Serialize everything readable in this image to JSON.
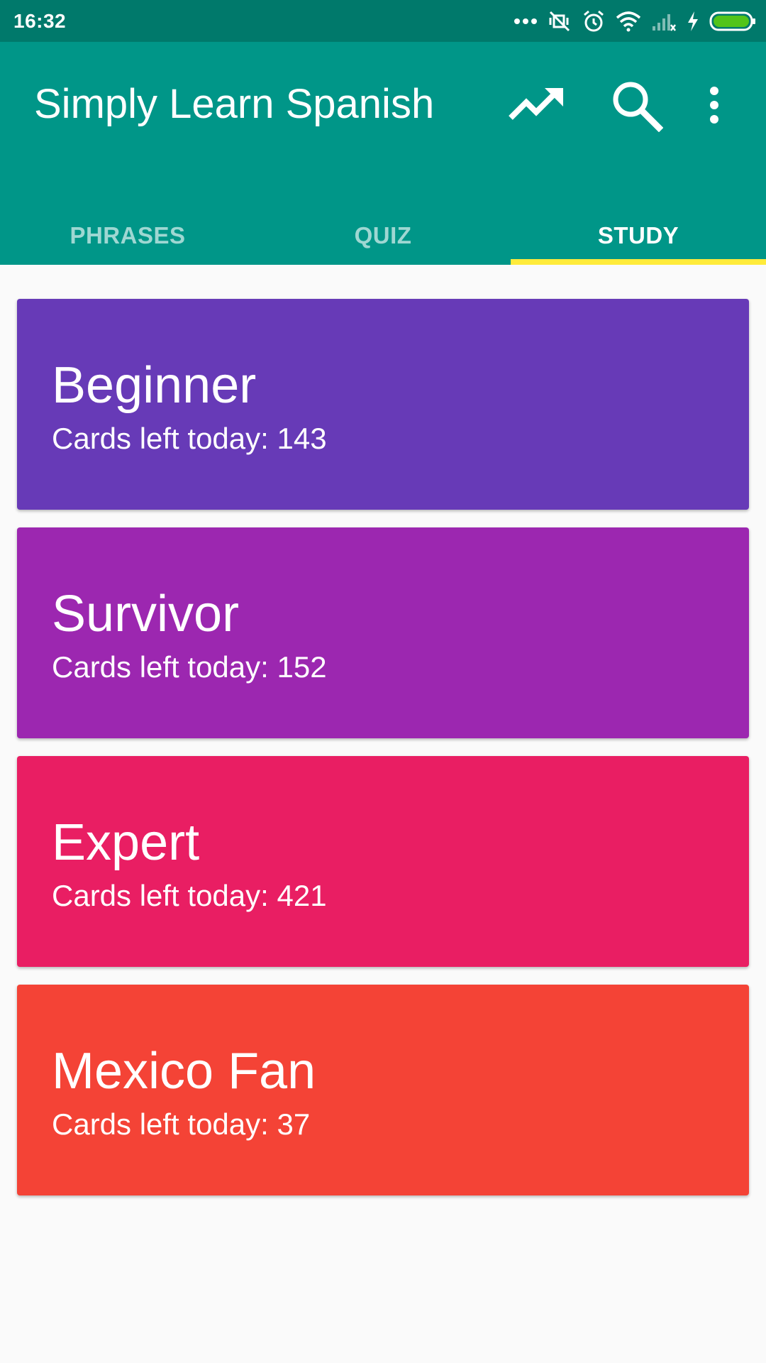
{
  "status_bar": {
    "time": "16:32",
    "icons": [
      "more-dots-icon",
      "vibrate-off-icon",
      "alarm-icon",
      "wifi-icon",
      "signal-icon",
      "charging-icon",
      "battery-icon"
    ]
  },
  "app_bar": {
    "title": "Simply Learn Spanish",
    "actions": [
      "trending-up-icon",
      "search-icon",
      "more-vert-icon"
    ]
  },
  "tabs": [
    {
      "label": "PHRASES",
      "active": false
    },
    {
      "label": "QUIZ",
      "active": false
    },
    {
      "label": "STUDY",
      "active": true
    }
  ],
  "cards_label": "Cards left today:",
  "decks": [
    {
      "name": "Beginner",
      "cards_left": "143",
      "color": "#673ab7"
    },
    {
      "name": "Survivor",
      "cards_left": "152",
      "color": "#9c27b0"
    },
    {
      "name": "Expert",
      "cards_left": "421",
      "color": "#e91e63"
    },
    {
      "name": "Mexico Fan",
      "cards_left": "37",
      "color": "#f44336"
    }
  ],
  "colors": {
    "status_bar": "#00796b",
    "app_bar": "#009688",
    "tab_indicator": "#ffeb3b",
    "background": "#fafafa"
  }
}
